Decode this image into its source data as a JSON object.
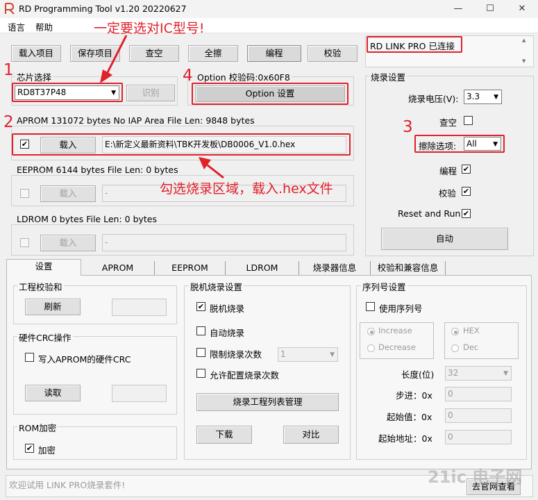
{
  "window": {
    "title": "RD Programming Tool v1.20 20220627",
    "minimize": "—",
    "maximize": "☐",
    "close": "✕"
  },
  "menu": [
    "语言",
    "帮助"
  ],
  "toolbar": {
    "load_project": "载入项目",
    "save_project": "保存项目",
    "check_blank": "查空",
    "erase_all": "全擦",
    "program": "编程",
    "verify": "校验"
  },
  "status_box": "RD LINK PRO 已连接",
  "chip": {
    "group_label": "芯片选择",
    "selected": "RD8T37P48",
    "identify": "识别"
  },
  "option": {
    "label": "Option  校验码:0x60F8",
    "button": "Option 设置"
  },
  "aprom": {
    "label": "APROM 131072 bytes  No IAP Area    File Len: 9848 bytes",
    "checked": "✔",
    "load": "载入",
    "path": "E:\\新定义最新资料\\TBK开发板\\DB0006_V1.0.hex"
  },
  "eeprom": {
    "label": "EEPROM 6144 bytes    File Len: 0 bytes",
    "load": "载入",
    "path": "-"
  },
  "ldrom": {
    "label": "LDROM 0 bytes     File Len: 0 bytes",
    "load": "载入",
    "path": "-"
  },
  "burn": {
    "group_label": "烧录设置",
    "voltage_label": "烧录电压(V):",
    "voltage_value": "3.3",
    "check_blank_label": "查空",
    "erase_label": "擦除选项:",
    "erase_value": "All",
    "program_label": "编程",
    "program_checked": "✔",
    "verify_label": "校验",
    "verify_checked": "✔",
    "reset_label": "Reset and Run",
    "reset_checked": "✔",
    "auto_button": "自动"
  },
  "tabs": [
    "设置",
    "APROM",
    "EEPROM",
    "LDROM",
    "烧录器信息",
    "校验和兼容信息"
  ],
  "checksum": {
    "group_label": "工程校验和",
    "refresh": "刷新"
  },
  "crc": {
    "group_label": "硬件CRC操作",
    "write_label": "写入APROM的硬件CRC",
    "read": "读取"
  },
  "rom_encrypt": {
    "group_label": "ROM加密",
    "label": "加密",
    "checked": "✔"
  },
  "offline": {
    "group_label": "脱机烧录设置",
    "offline_label": "脱机烧录",
    "offline_checked": "✔",
    "auto_label": "自动烧录",
    "limit_label": "限制烧录次数",
    "limit_value": "1",
    "allow_label": "允许配置烧录次数",
    "manage_button": "烧录工程列表管理",
    "download": "下载",
    "compare": "对比"
  },
  "serial": {
    "group_label": "序列号设置",
    "use_label": "使用序列号",
    "increase": "Increase",
    "decrease": "Decrease",
    "hex": "HEX",
    "dec": "Dec",
    "length_label": "长度(位)",
    "length_value": "32",
    "step_label": "步进：0x",
    "step_value": "0",
    "start_label": "起始值：0x",
    "start_value": "0",
    "addr_label": "起始地址：0x",
    "addr_value": "0"
  },
  "log_text": "欢迎试用 LINK PRO烧录套件!",
  "website_button": "去官网查看",
  "watermark": "21ic 电子网",
  "annotations": {
    "top": "一定要选对IC型号!",
    "mid": "勾选烧录区域，载入.hex文件",
    "n1": "1",
    "n2": "2",
    "n3": "3",
    "n4": "4"
  },
  "colors": {
    "annotation": "#e0202a",
    "window_bg": "#f0f0f0"
  }
}
